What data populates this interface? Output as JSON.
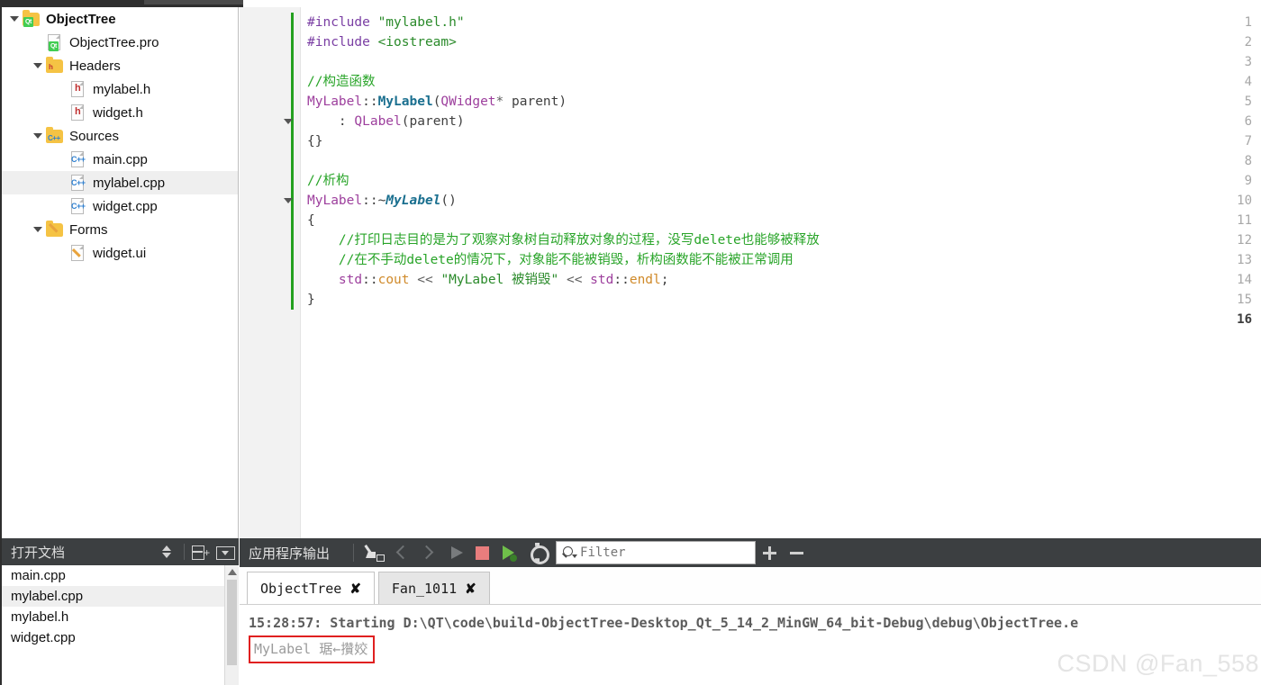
{
  "project_tree": {
    "items": [
      {
        "label": "ObjectTree",
        "indent": 0,
        "icon": "folder-qt-icon",
        "expander": "expanded",
        "bold": true,
        "selected": false
      },
      {
        "label": "ObjectTree.pro",
        "indent": 1,
        "icon": "file-qt-pro-icon",
        "expander": "none",
        "bold": false,
        "selected": false
      },
      {
        "label": "Headers",
        "indent": 1,
        "icon": "folder-headers-icon",
        "expander": "expanded",
        "bold": false,
        "selected": false
      },
      {
        "label": "mylabel.h",
        "indent": 2,
        "icon": "file-header-icon",
        "expander": "none",
        "bold": false,
        "selected": false
      },
      {
        "label": "widget.h",
        "indent": 2,
        "icon": "file-header-icon",
        "expander": "none",
        "bold": false,
        "selected": false
      },
      {
        "label": "Sources",
        "indent": 1,
        "icon": "folder-sources-icon",
        "expander": "expanded",
        "bold": false,
        "selected": false
      },
      {
        "label": "main.cpp",
        "indent": 2,
        "icon": "file-cpp-icon",
        "expander": "none",
        "bold": false,
        "selected": false
      },
      {
        "label": "mylabel.cpp",
        "indent": 2,
        "icon": "file-cpp-icon",
        "expander": "none",
        "bold": false,
        "selected": true
      },
      {
        "label": "widget.cpp",
        "indent": 2,
        "icon": "file-cpp-icon",
        "expander": "none",
        "bold": false,
        "selected": false
      },
      {
        "label": "Forms",
        "indent": 1,
        "icon": "folder-forms-icon",
        "expander": "expanded",
        "bold": false,
        "selected": false
      },
      {
        "label": "widget.ui",
        "indent": 2,
        "icon": "file-ui-icon",
        "expander": "none",
        "bold": false,
        "selected": false
      }
    ]
  },
  "editor": {
    "current_line": 16,
    "lines": [
      {
        "n": 1,
        "tokens": [
          {
            "t": "#include ",
            "c": "k-pre"
          },
          {
            "t": "\"mylabel.h\"",
            "c": "k-str"
          }
        ]
      },
      {
        "n": 2,
        "tokens": [
          {
            "t": "#include ",
            "c": "k-pre"
          },
          {
            "t": "<iostream>",
            "c": "k-str"
          }
        ]
      },
      {
        "n": 3,
        "tokens": []
      },
      {
        "n": 4,
        "tokens": [
          {
            "t": "//构造函数",
            "c": "k-cmt"
          }
        ]
      },
      {
        "n": 5,
        "tokens": [
          {
            "t": "MyLabel",
            "c": "k-type"
          },
          {
            "t": "::",
            "c": "k-pun"
          },
          {
            "t": "MyLabel",
            "c": "k-fn2"
          },
          {
            "t": "(",
            "c": "k-pun"
          },
          {
            "t": "QWidget",
            "c": "k-type"
          },
          {
            "t": "* ",
            "c": "k-op"
          },
          {
            "t": "parent",
            "c": "k-var"
          },
          {
            "t": ")",
            "c": "k-pun"
          }
        ]
      },
      {
        "n": 6,
        "tokens": [
          {
            "t": "    : ",
            "c": "k-pun"
          },
          {
            "t": "QLabel",
            "c": "k-type"
          },
          {
            "t": "(",
            "c": "k-pun"
          },
          {
            "t": "parent",
            "c": "k-var"
          },
          {
            "t": ")",
            "c": "k-pun"
          }
        ]
      },
      {
        "n": 7,
        "tokens": [
          {
            "t": "{}",
            "c": "k-pun"
          }
        ]
      },
      {
        "n": 8,
        "tokens": []
      },
      {
        "n": 9,
        "tokens": [
          {
            "t": "//析构",
            "c": "k-cmt"
          }
        ]
      },
      {
        "n": 10,
        "tokens": [
          {
            "t": "MyLabel",
            "c": "k-type"
          },
          {
            "t": "::~",
            "c": "k-pun"
          },
          {
            "t": "MyLabel",
            "c": "k-fn"
          },
          {
            "t": "()",
            "c": "k-pun"
          }
        ]
      },
      {
        "n": 11,
        "tokens": [
          {
            "t": "{",
            "c": "k-pun"
          }
        ]
      },
      {
        "n": 12,
        "tokens": [
          {
            "t": "    //打印日志目的是为了观察对象树自动释放对象的过程，没写delete也能够被释放",
            "c": "k-cmt"
          }
        ]
      },
      {
        "n": 13,
        "tokens": [
          {
            "t": "    //在不手动delete的情况下，对象能不能被销毁，析构函数能不能被正常调用",
            "c": "k-cmt"
          }
        ]
      },
      {
        "n": 14,
        "tokens": [
          {
            "t": "    ",
            "c": "k-pun"
          },
          {
            "t": "std",
            "c": "k-type"
          },
          {
            "t": "::",
            "c": "k-pun"
          },
          {
            "t": "cout",
            "c": "k-obj"
          },
          {
            "t": " << ",
            "c": "k-op"
          },
          {
            "t": "\"MyLabel 被销毁\"",
            "c": "k-str"
          },
          {
            "t": " << ",
            "c": "k-op"
          },
          {
            "t": "std",
            "c": "k-type"
          },
          {
            "t": "::",
            "c": "k-pun"
          },
          {
            "t": "endl",
            "c": "k-obj"
          },
          {
            "t": ";",
            "c": "k-pun"
          }
        ]
      },
      {
        "n": 15,
        "tokens": [
          {
            "t": "}",
            "c": "k-pun"
          }
        ]
      },
      {
        "n": 16,
        "tokens": []
      }
    ],
    "change_bars": [
      {
        "from": 1,
        "to": 6
      },
      {
        "from": 7,
        "to": 15
      }
    ],
    "fold_markers": [
      6,
      10
    ],
    "change_bar_color": "#23a01f"
  },
  "open_documents": {
    "title": "打开文档",
    "header_icons": [
      {
        "name": "sort-toggle-icon"
      },
      {
        "name": "split-add-icon"
      },
      {
        "name": "dropdown-menu-icon"
      }
    ],
    "files": [
      {
        "label": "main.cpp",
        "selected": false
      },
      {
        "label": "mylabel.cpp",
        "selected": true
      },
      {
        "label": "mylabel.h",
        "selected": false
      },
      {
        "label": "widget.cpp",
        "selected": false
      }
    ]
  },
  "output_pane": {
    "title": "应用程序输出",
    "toolbar_icons": [
      {
        "name": "clear-output-icon",
        "state": "enabled"
      },
      {
        "name": "prev-item-icon",
        "state": "disabled"
      },
      {
        "name": "next-item-icon",
        "state": "disabled"
      },
      {
        "name": "run-icon",
        "state": "disabled"
      },
      {
        "name": "stop-icon",
        "state": "enabled"
      },
      {
        "name": "rerun-debug-icon",
        "state": "enabled"
      },
      {
        "name": "settings-gear-icon",
        "state": "enabled"
      }
    ],
    "filter": {
      "placeholder": "Filter",
      "value": ""
    },
    "zoom_in_label": "+",
    "zoom_out_label": "−",
    "tabs": [
      {
        "label": "ObjectTree",
        "active": true,
        "close_label": "✘"
      },
      {
        "label": "Fan_1011",
        "active": false,
        "close_label": "✘"
      }
    ],
    "console": {
      "start_line": "15:28:57: Starting D:\\QT\\code\\build-ObjectTree-Desktop_Qt_5_14_2_MinGW_64_bit-Debug\\debug\\ObjectTree.e",
      "garbled_line": "MyLabel 琚←攢姣",
      "highlight_color": "#e02020"
    }
  },
  "watermark": "CSDN @Fan_558"
}
